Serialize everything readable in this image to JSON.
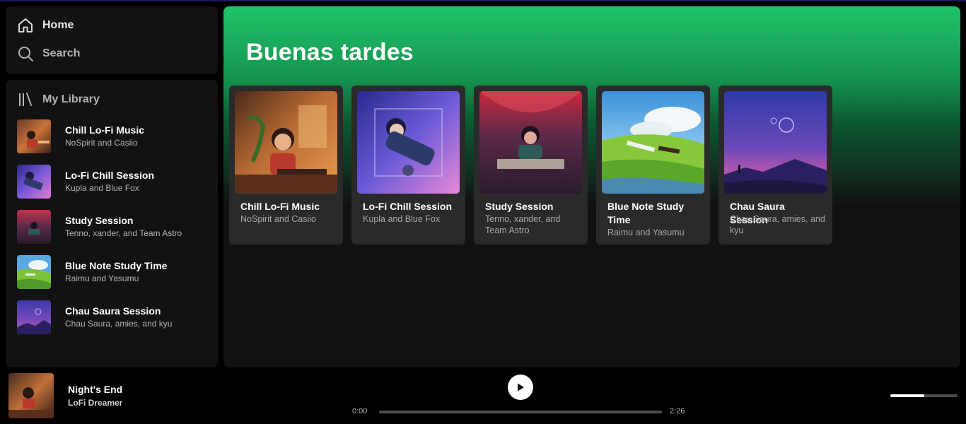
{
  "nav": {
    "home_label": "Home",
    "search_label": "Search"
  },
  "library": {
    "title": "My Library",
    "items": [
      {
        "title": "Chill Lo-Fi Music",
        "subtitle": "NoSpirit and Casiio"
      },
      {
        "title": "Lo-Fi Chill Session",
        "subtitle": "Kupla and Blue Fox"
      },
      {
        "title": "Study Session",
        "subtitle": "Tenno, xander, and Team Astro"
      },
      {
        "title": "Blue Note Study Time",
        "subtitle": "Raimu and Yasumu"
      },
      {
        "title": "Chau Saura Session",
        "subtitle": "Chau Saura, amies, and kyu"
      }
    ]
  },
  "main": {
    "greeting": "Buenas tardes",
    "gradient_color": "#1ed760",
    "cards": [
      {
        "title": "Chill Lo-Fi Music",
        "subtitle": "NoSpirit and Casiio"
      },
      {
        "title": "Lo-Fi Chill Session",
        "subtitle": "Kupla and Blue Fox"
      },
      {
        "title": "Study Session",
        "subtitle": "Tenno, xander, and Team Astro"
      },
      {
        "title": "Blue Note Study Time",
        "subtitle": "Raimu and Yasumu"
      },
      {
        "title": "Chau Saura Session",
        "subtitle": "Chau Saura, amies, and kyu"
      }
    ]
  },
  "player": {
    "track_title": "Night's End",
    "artist": "LoFi Dreamer",
    "current_time": "0:00",
    "total_time": "2:26",
    "progress_fraction": 0,
    "volume_fraction": 0.5,
    "play_icon": "play-icon"
  }
}
